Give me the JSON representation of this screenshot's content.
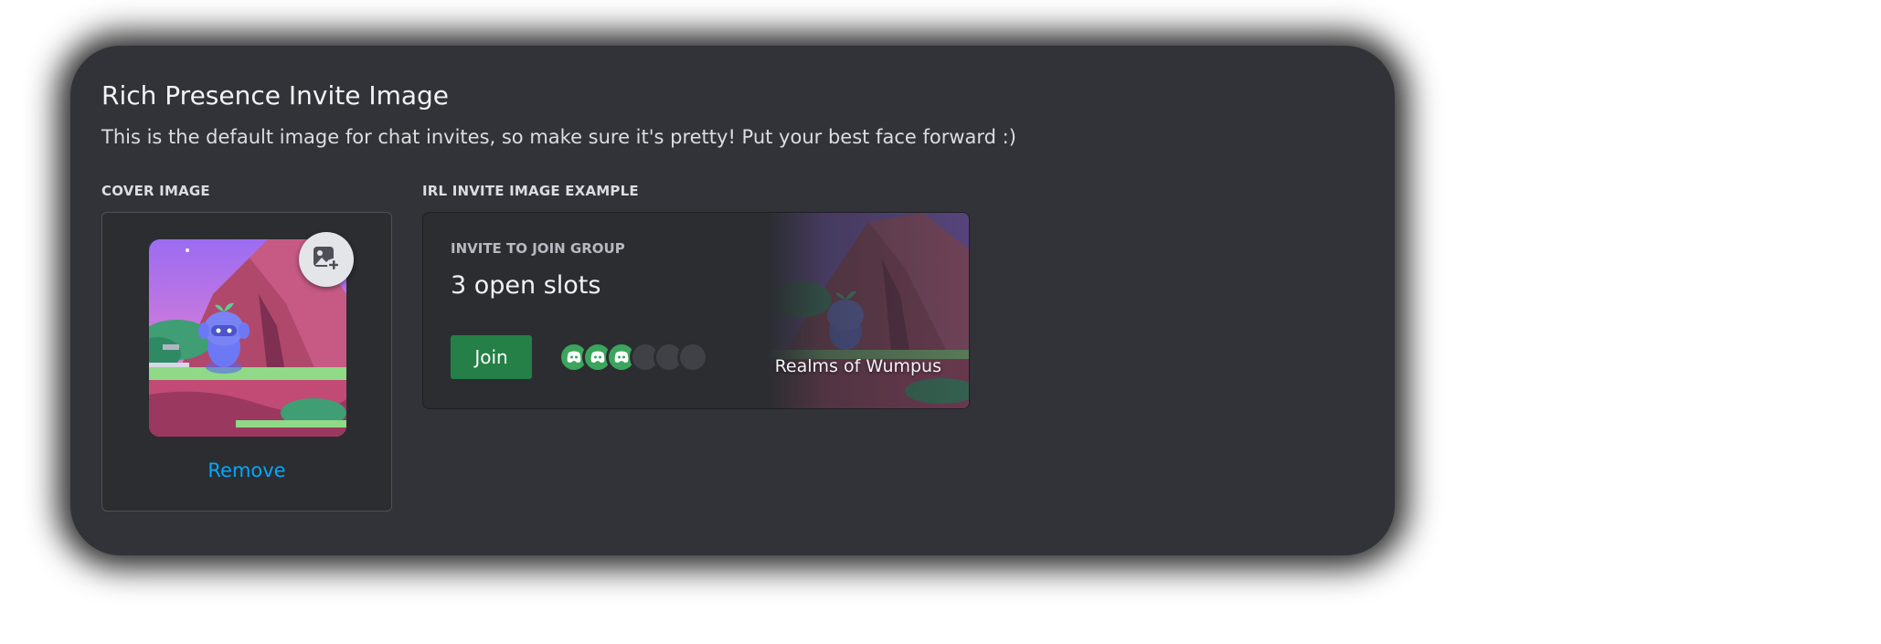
{
  "panel": {
    "title": "Rich Presence Invite Image",
    "subtitle": "This is the default image for chat invites, so make sure it's pretty! Put your best face forward :)"
  },
  "cover": {
    "label": "COVER IMAGE",
    "remove_label": "Remove",
    "upload_icon": "image-plus-icon"
  },
  "example": {
    "label": "IRL INVITE IMAGE EXAMPLE",
    "heading": "INVITE TO JOIN GROUP",
    "slots_text": "3 open slots",
    "join_label": "Join",
    "game_name": "Realms of Wumpus",
    "party_filled": 3,
    "party_open": 3,
    "avatar_icon": "discord-logo-icon"
  },
  "colors": {
    "panel_bg": "#313338",
    "card_bg": "#2b2d31",
    "link": "#00a8fc",
    "join_button": "#248046",
    "member": "#3ba55c",
    "open_slot": "#3f4147"
  }
}
